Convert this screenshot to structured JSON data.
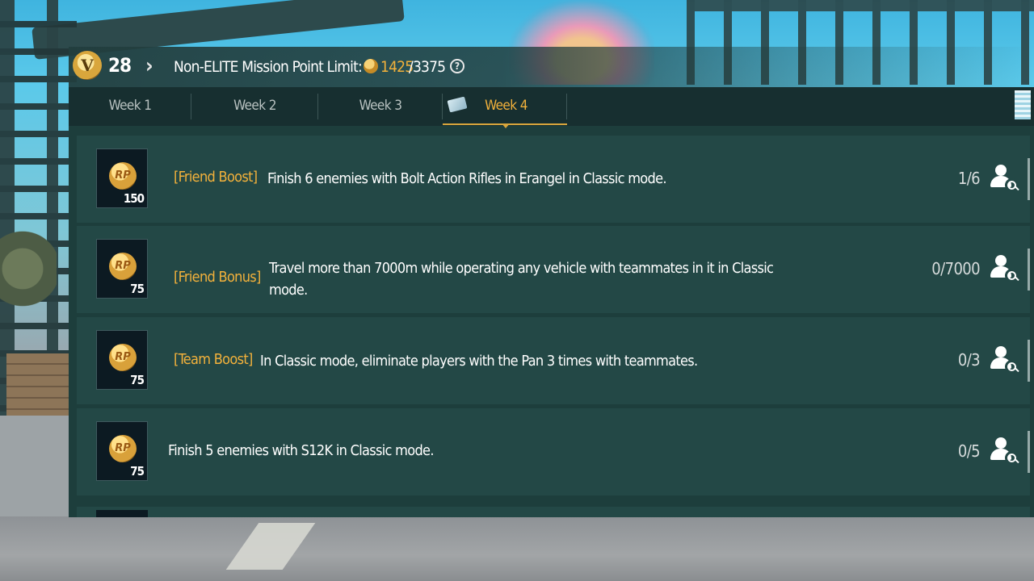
{
  "header": {
    "level": "28",
    "level_badge_letter": "V",
    "limit_label": "Non-ELITE Mission Point Limit:",
    "limit_current": "1425",
    "limit_max": "/3375",
    "help_symbol": "?"
  },
  "tabs": [
    {
      "label": "Week 1",
      "active": false
    },
    {
      "label": "Week 2",
      "active": false
    },
    {
      "label": "Week 3",
      "active": false
    },
    {
      "label": "Week 4",
      "active": true
    }
  ],
  "missions": [
    {
      "tag": "[Friend Boost]",
      "description": "Finish 6 enemies with Bolt Action Rifles in Erangel in Classic mode.",
      "reward_icon": "RP",
      "reward_qty": "150",
      "progress": "1/6",
      "action_icon": "friend-search-icon"
    },
    {
      "tag": "[Friend Bonus]",
      "description": "Travel more than 7000m while operating any vehicle with teammates in it in Classic mode.",
      "reward_icon": "RP",
      "reward_qty": "75",
      "progress": "0/7000",
      "action_icon": "friend-search-icon"
    },
    {
      "tag": "[Team Boost]",
      "description": "In Classic mode, eliminate players with the Pan 3 times with teammates.",
      "reward_icon": "RP",
      "reward_qty": "75",
      "progress": "0/3",
      "action_icon": "friend-search-icon"
    },
    {
      "tag": "",
      "description": "Finish 5 enemies with S12K in Classic mode.",
      "reward_icon": "RP",
      "reward_qty": "75",
      "progress": "0/5",
      "action_icon": "friend-search-icon"
    }
  ],
  "colors": {
    "accent": "#f2b13b",
    "panel": "#1d3e3c",
    "row": "#234846"
  }
}
